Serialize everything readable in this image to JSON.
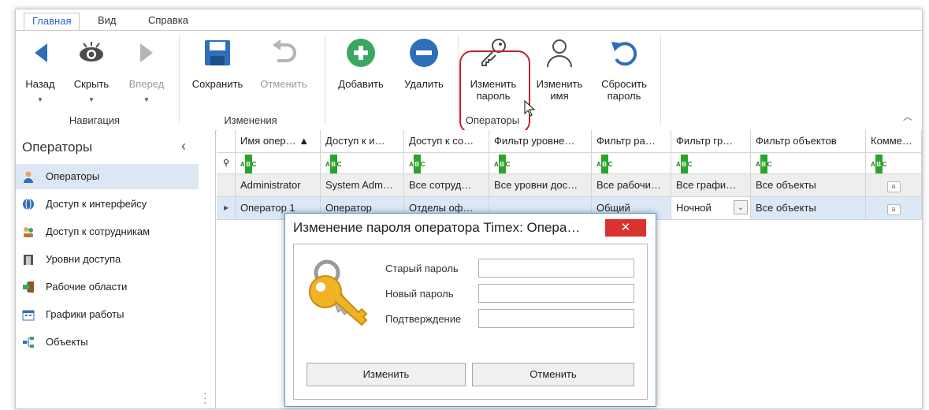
{
  "tabs": [
    "Главная",
    "Вид",
    "Справка"
  ],
  "ribbon": {
    "nav": {
      "back": "Назад",
      "hide": "Скрыть",
      "forward": "Вперед",
      "group": "Навигация"
    },
    "changes": {
      "save": "Сохранить",
      "cancel": "Отменить",
      "group": "Изменения"
    },
    "operators": {
      "add": "Добавить",
      "remove": "Удалить",
      "change_pwd_1": "Изменить",
      "change_pwd_2": "пароль",
      "change_name_1": "Изменить",
      "change_name_2": "имя",
      "reset_pwd_1": "Сбросить",
      "reset_pwd_2": "пароль",
      "group": "Операторы"
    }
  },
  "sidebar": {
    "title": "Операторы",
    "items": [
      {
        "label": "Операторы"
      },
      {
        "label": "Доступ к интерфейсу"
      },
      {
        "label": "Доступ к сотрудникам"
      },
      {
        "label": "Уровни доступа"
      },
      {
        "label": "Рабочие области"
      },
      {
        "label": "Графики работы"
      },
      {
        "label": "Объекты"
      }
    ]
  },
  "grid": {
    "columns": [
      "Имя опер… ▲",
      "Доступ к и…",
      "Доступ к со…",
      "Фильтр уровне…",
      "Фильтр ра…",
      "Фильтр гр…",
      "Фильтр объектов",
      "Комме…"
    ],
    "rows": [
      [
        "Administrator",
        "System Adm…",
        "Все сотруд…",
        "Все уровни дос…",
        "Все рабочи…",
        "Все графи…",
        "Все объекты"
      ],
      [
        "Оператор 1",
        "Оператор",
        "Отделы оф…",
        "",
        "Общий",
        "Ночной",
        "Все объекты"
      ]
    ]
  },
  "dialog": {
    "title": "Изменение пароля оператора Timex: Опера…",
    "old_label": "Старый пароль",
    "new_label": "Новый пароль",
    "confirm_label": "Подтверждение",
    "ok": "Изменить",
    "cancel": "Отменить"
  },
  "colors": {
    "accent": "#2f6fba",
    "green": "#3aa662",
    "close": "#d9322f",
    "highlight": "#c0252a"
  }
}
